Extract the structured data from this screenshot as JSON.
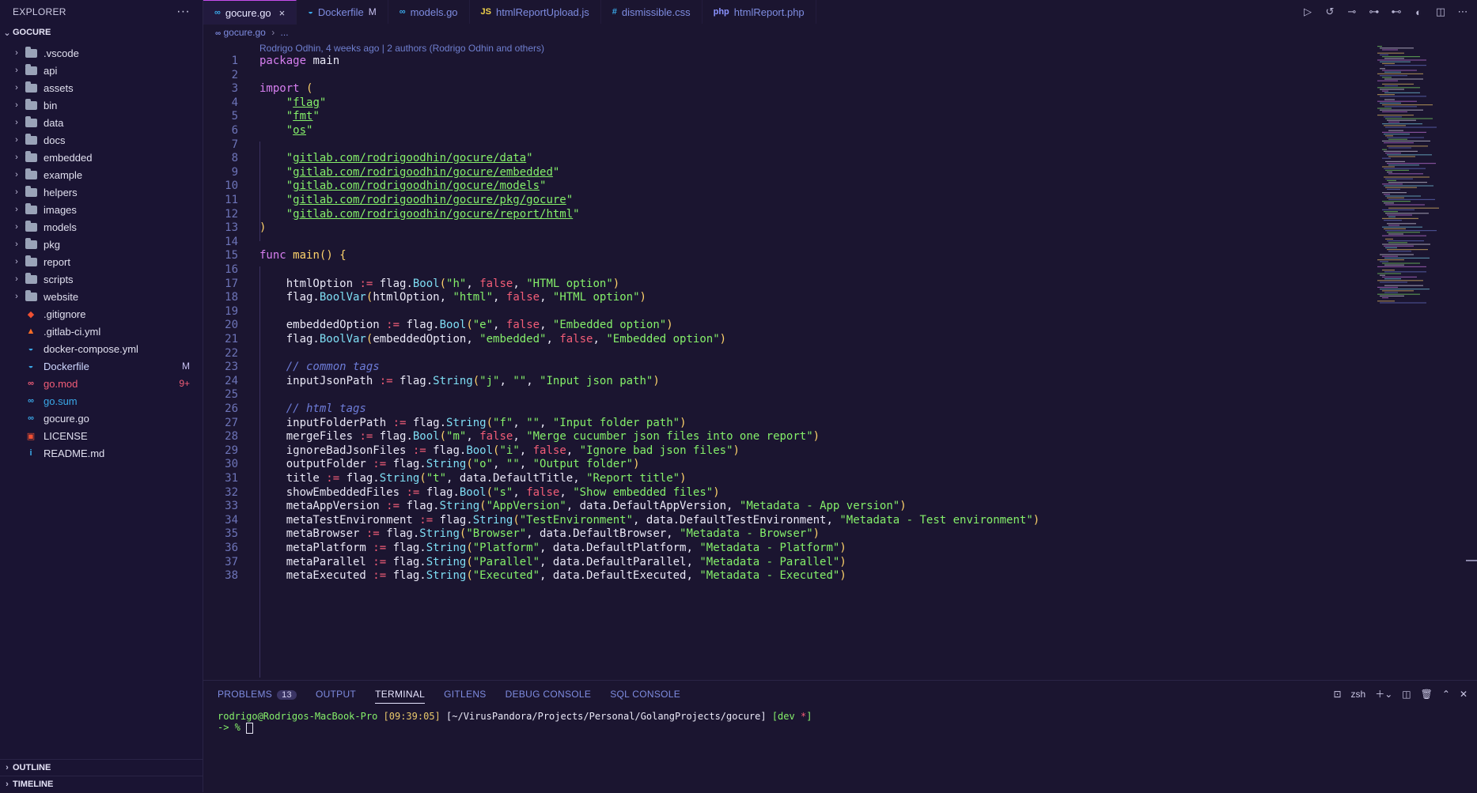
{
  "sidebar": {
    "title": "EXPLORER",
    "more": "···",
    "root": "GOCURE",
    "folders": [
      ".vscode",
      "api",
      "assets",
      "bin",
      "data",
      "docs",
      "embedded",
      "example",
      "helpers",
      "images",
      "models",
      "pkg",
      "report",
      "scripts",
      "website"
    ],
    "files": [
      {
        "name": ".gitignore",
        "icon": "git-icon",
        "color": "#f05033",
        "glyph": "◆",
        "badge": ""
      },
      {
        "name": ".gitlab-ci.yml",
        "icon": "gitlab-icon",
        "color": "#fc6d26",
        "glyph": "▲",
        "badge": ""
      },
      {
        "name": "docker-compose.yml",
        "icon": "docker-icon",
        "color": "#3aa8e8",
        "glyph": "◒",
        "badge": ""
      },
      {
        "name": "Dockerfile",
        "icon": "docker-icon",
        "color": "#3aa8e8",
        "glyph": "◒",
        "badge": "M"
      },
      {
        "name": "go.mod",
        "icon": "go-icon",
        "color": "#f25d77",
        "glyph": "∞",
        "badge": "9+"
      },
      {
        "name": "go.sum",
        "icon": "go-icon",
        "color": "#3aa8e8",
        "glyph": "∞",
        "badge": ""
      },
      {
        "name": "gocure.go",
        "icon": "go-icon",
        "color": "#3aa8e8",
        "glyph": "∞",
        "badge": ""
      },
      {
        "name": "LICENSE",
        "icon": "license-icon",
        "color": "#f05033",
        "glyph": "▣",
        "badge": ""
      },
      {
        "name": "README.md",
        "icon": "info-icon",
        "color": "#3aa8e8",
        "glyph": "i",
        "badge": ""
      }
    ],
    "outline": "OUTLINE",
    "timeline": "TIMELINE"
  },
  "tabs": [
    {
      "label": "gocure.go",
      "icon": "∞",
      "active": true,
      "modified": "",
      "close": "×"
    },
    {
      "label": "Dockerfile",
      "icon": "◒",
      "active": false,
      "modified": "M",
      "close": ""
    },
    {
      "label": "models.go",
      "icon": "∞",
      "active": false,
      "modified": "",
      "close": ""
    },
    {
      "label": "htmlReportUpload.js",
      "icon": "JS",
      "active": false,
      "modified": "",
      "close": ""
    },
    {
      "label": "dismissible.css",
      "icon": "#",
      "active": false,
      "modified": "",
      "close": ""
    },
    {
      "label": "htmlReport.php",
      "icon": "php",
      "active": false,
      "modified": "",
      "close": ""
    }
  ],
  "breadcrumb": {
    "file": "gocure.go",
    "more": "..."
  },
  "blame": "Rodrigo Odhin, 4 weeks ago | 2 authors (Rodrigo Odhin and others)",
  "code_lines": [
    "package main",
    "",
    "import (",
    "    \"flag\"",
    "    \"fmt\"",
    "    \"os\"",
    "",
    "    \"gitlab.com/rodrigoodhin/gocure/data\"",
    "    \"gitlab.com/rodrigoodhin/gocure/embedded\"",
    "    \"gitlab.com/rodrigoodhin/gocure/models\"",
    "    \"gitlab.com/rodrigoodhin/gocure/pkg/gocure\"",
    "    \"gitlab.com/rodrigoodhin/gocure/report/html\"",
    ")",
    "",
    "func main() {",
    "",
    "    htmlOption := flag.Bool(\"h\", false, \"HTML option\")",
    "    flag.BoolVar(htmlOption, \"html\", false, \"HTML option\")",
    "",
    "    embeddedOption := flag.Bool(\"e\", false, \"Embedded option\")",
    "    flag.BoolVar(embeddedOption, \"embedded\", false, \"Embedded option\")",
    "",
    "    // common tags",
    "    inputJsonPath := flag.String(\"j\", \"\", \"Input json path\")",
    "",
    "    // html tags",
    "    inputFolderPath := flag.String(\"f\", \"\", \"Input folder path\")",
    "    mergeFiles := flag.Bool(\"m\", false, \"Merge cucumber json files into one report\")",
    "    ignoreBadJsonFiles := flag.Bool(\"i\", false, \"Ignore bad json files\")",
    "    outputFolder := flag.String(\"o\", \"\", \"Output folder\")",
    "    title := flag.String(\"t\", data.DefaultTitle, \"Report title\")",
    "    showEmbeddedFiles := flag.Bool(\"s\", false, \"Show embedded files\")",
    "    metaAppVersion := flag.String(\"AppVersion\", data.DefaultAppVersion, \"Metadata - App version\")",
    "    metaTestEnvironment := flag.String(\"TestEnvironment\", data.DefaultTestEnvironment, \"Metadata - Test environment\")",
    "    metaBrowser := flag.String(\"Browser\", data.DefaultBrowser, \"Metadata - Browser\")",
    "    metaPlatform := flag.String(\"Platform\", data.DefaultPlatform, \"Metadata - Platform\")",
    "    metaParallel := flag.String(\"Parallel\", data.DefaultParallel, \"Metadata - Parallel\")",
    "    metaExecuted := flag.String(\"Executed\", data.DefaultExecuted, \"Metadata - Executed\")"
  ],
  "panel": {
    "tabs": [
      {
        "label": "PROBLEMS",
        "badge": "13",
        "active": false
      },
      {
        "label": "OUTPUT",
        "badge": "",
        "active": false
      },
      {
        "label": "TERMINAL",
        "badge": "",
        "active": true
      },
      {
        "label": "GITLENS",
        "badge": "",
        "active": false
      },
      {
        "label": "DEBUG CONSOLE",
        "badge": "",
        "active": false
      },
      {
        "label": "SQL CONSOLE",
        "badge": "",
        "active": false
      }
    ],
    "shell": "zsh"
  },
  "terminal": {
    "user": "rodrigo@Rodrigos-MacBook-Pro",
    "time": "[09:39:05]",
    "path": "[~/VirusPandora/Projects/Personal/GolangProjects/gocure]",
    "branch_open": "[dev ",
    "branch_star": "*",
    "branch_close": "]",
    "prompt": "-> %"
  }
}
